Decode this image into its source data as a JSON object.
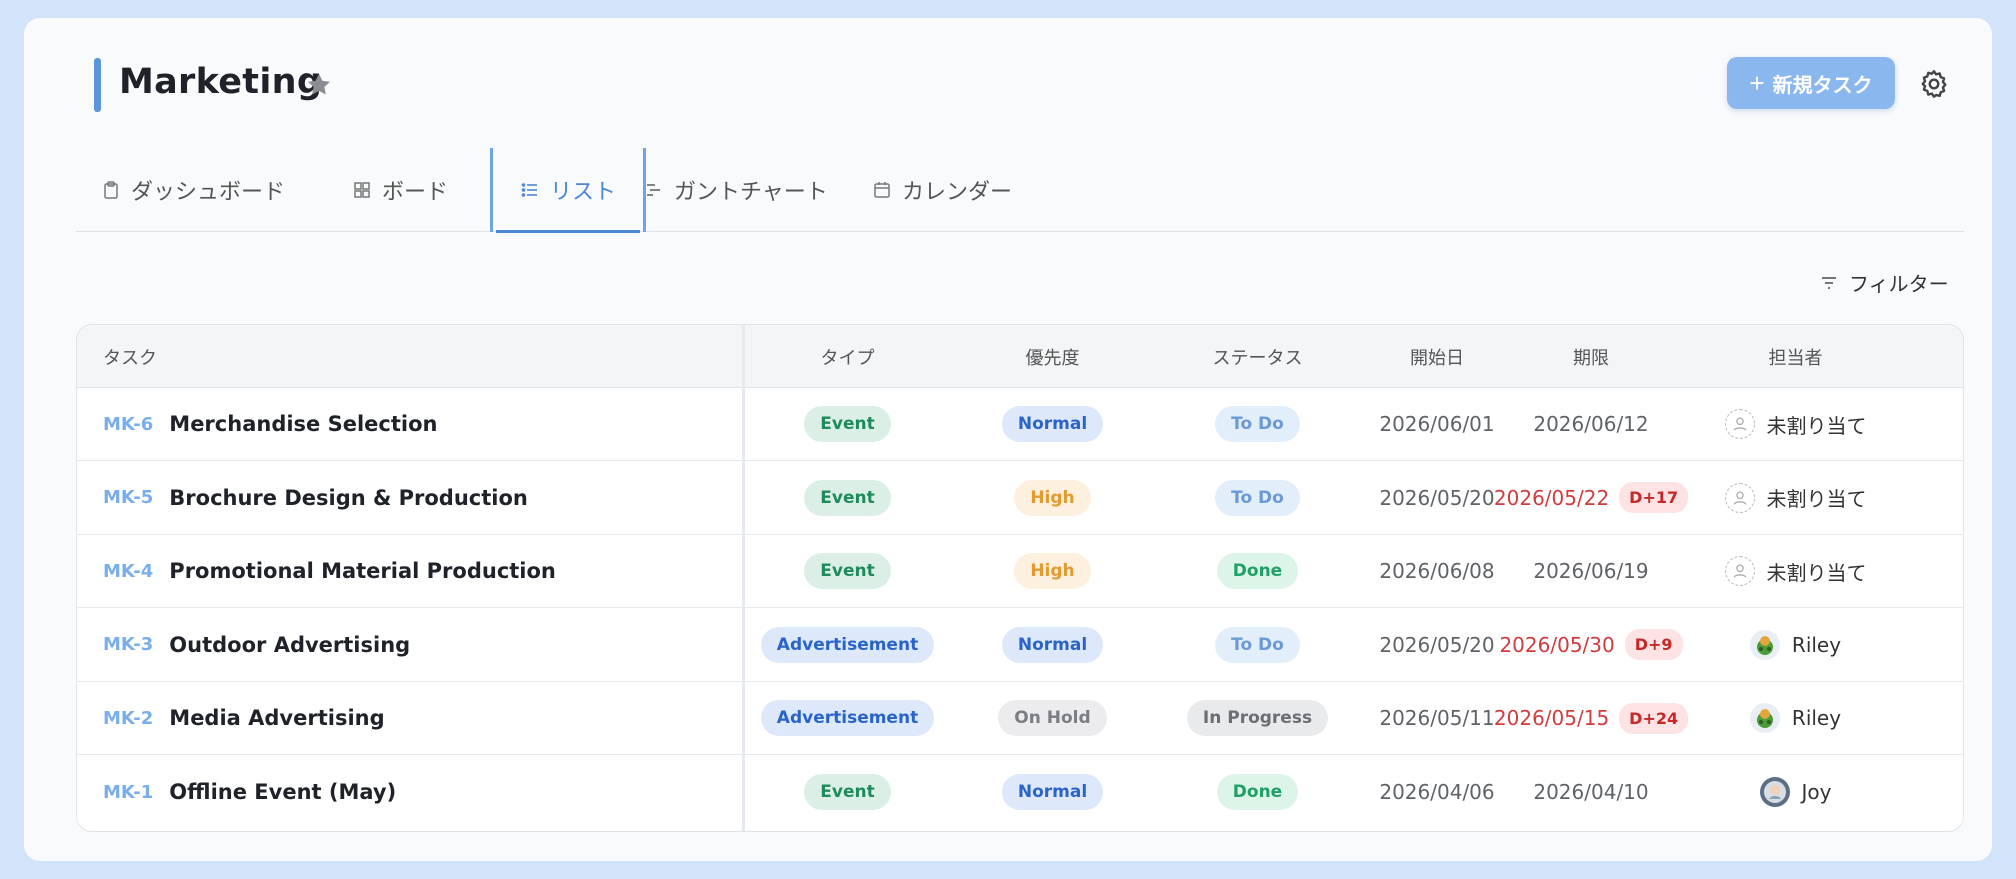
{
  "project": {
    "title": "Marketing"
  },
  "header": {
    "new_task_label": "新規タスク"
  },
  "tabs": [
    {
      "label": "ダッシュボード",
      "icon": "clipboard-icon"
    },
    {
      "label": "ボード",
      "icon": "grid-icon"
    },
    {
      "label": "リスト",
      "icon": "list-icon",
      "active": true
    },
    {
      "label": "ガントチャート",
      "icon": "gantt-icon"
    },
    {
      "label": "カレンダー",
      "icon": "calendar-icon"
    }
  ],
  "filter": {
    "label": "フィルター"
  },
  "table": {
    "columns": {
      "task": "タスク",
      "type": "タイプ",
      "priority": "優先度",
      "status": "ステータス",
      "start": "開始日",
      "due": "期限",
      "assignee": "担当者"
    },
    "rows": [
      {
        "key": "MK-6",
        "name": "Merchandise Selection",
        "type": "Event",
        "priority": "Normal",
        "status": "To Do",
        "start": "2026/06/01",
        "due": "2026/06/12",
        "overdue": "",
        "assignee": "未割り当て"
      },
      {
        "key": "MK-5",
        "name": "Brochure Design & Production",
        "type": "Event",
        "priority": "High",
        "status": "To Do",
        "start": "2026/05/20",
        "due": "2026/05/22",
        "overdue": "D+17",
        "assignee": "未割り当て"
      },
      {
        "key": "MK-4",
        "name": "Promotional Material Production",
        "type": "Event",
        "priority": "High",
        "status": "Done",
        "start": "2026/06/08",
        "due": "2026/06/19",
        "overdue": "",
        "assignee": "未割り当て"
      },
      {
        "key": "MK-3",
        "name": "Outdoor Advertising",
        "type": "Advertisement",
        "priority": "Normal",
        "status": "To Do",
        "start": "2026/05/20",
        "due": "2026/05/30",
        "overdue": "D+9",
        "assignee": "Riley"
      },
      {
        "key": "MK-2",
        "name": "Media Advertising",
        "type": "Advertisement",
        "priority": "On Hold",
        "status": "In Progress",
        "start": "2026/05/11",
        "due": "2026/05/15",
        "overdue": "D+24",
        "assignee": "Riley"
      },
      {
        "key": "MK-1",
        "name": "Offline Event (May)",
        "type": "Event",
        "priority": "Normal",
        "status": "Done",
        "start": "2026/04/06",
        "due": "2026/04/10",
        "overdue": "",
        "assignee": "Joy"
      }
    ]
  },
  "colors": {
    "accent": "#4a87d4",
    "event_bg": "#dcefe6",
    "event_fg": "#1f8a5b",
    "ad_bg": "#dde8fa",
    "ad_fg": "#2a64c8",
    "normal_bg": "#dde8fa",
    "normal_fg": "#2a64c8",
    "high_bg": "#fdf0df",
    "high_fg": "#e39a2f",
    "onhold_bg": "#ececee",
    "onhold_fg": "#7a7d82",
    "todo_bg": "#e3eefb",
    "todo_fg": "#6c9ad6",
    "done_bg": "#dcf5e8",
    "done_fg": "#20a065",
    "inprogress_bg": "#e9eaec",
    "inprogress_fg": "#6b6e73",
    "overdue": "#d13c3c"
  }
}
